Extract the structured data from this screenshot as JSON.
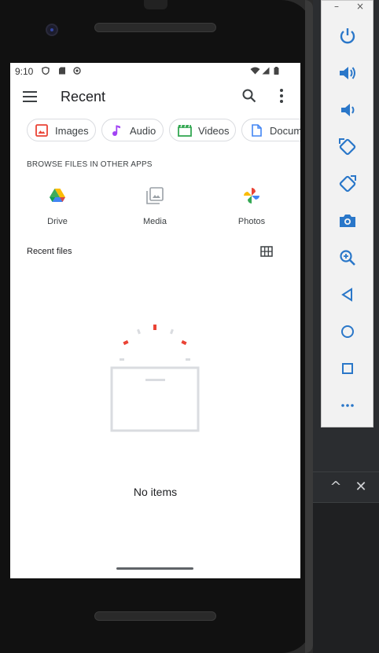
{
  "statusbar": {
    "time": "9:10"
  },
  "appbar": {
    "title": "Recent"
  },
  "chips": [
    {
      "label": "Images",
      "icon": "image-icon",
      "color": "#ea4335"
    },
    {
      "label": "Audio",
      "icon": "music-note-icon",
      "color": "#a142f4"
    },
    {
      "label": "Videos",
      "icon": "movie-icon",
      "color": "#34a853"
    },
    {
      "label": "Docum",
      "icon": "document-icon",
      "color": "#4285f4"
    }
  ],
  "browse": {
    "label": "BROWSE FILES IN OTHER APPS",
    "apps": [
      {
        "label": "Drive",
        "icon": "google-drive-icon"
      },
      {
        "label": "Media",
        "icon": "media-gallery-icon"
      },
      {
        "label": "Photos",
        "icon": "google-photos-icon"
      }
    ]
  },
  "recent": {
    "label": "Recent files"
  },
  "empty": {
    "text": "No items"
  },
  "emulator_toolbar": {
    "buttons": [
      "power-icon",
      "volume-up-icon",
      "volume-down-icon",
      "rotate-left-icon",
      "rotate-right-icon",
      "camera-icon",
      "zoom-icon",
      "back-icon",
      "home-icon",
      "overview-icon",
      "more-icon"
    ]
  },
  "colors": {
    "accent_red": "#ea4335",
    "toolbar_icon": "#2a77c9"
  }
}
